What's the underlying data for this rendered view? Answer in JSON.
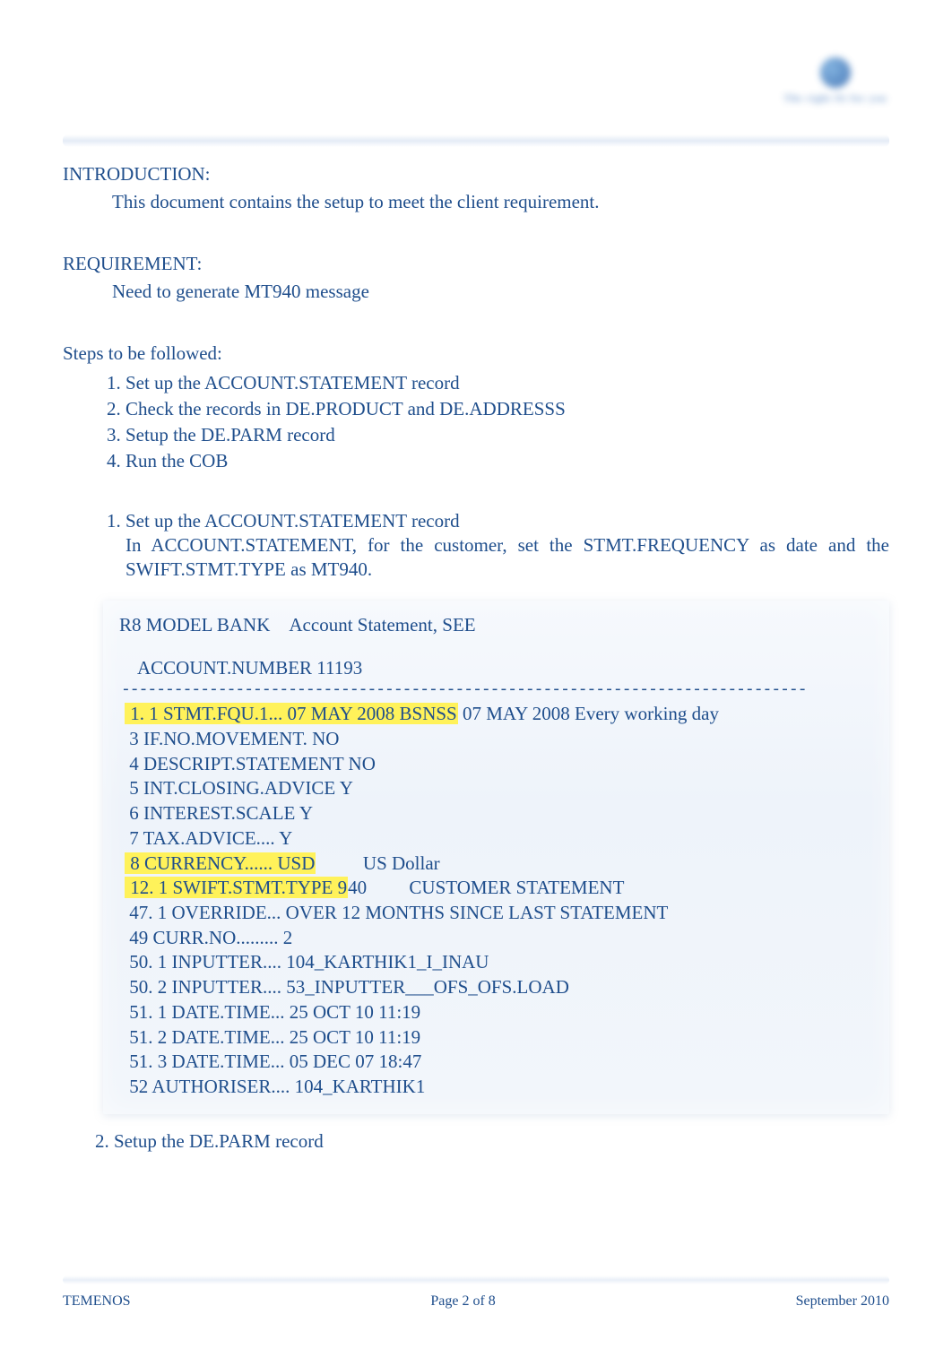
{
  "logo": {
    "name": "brand-logo",
    "caption": "The right fit for you"
  },
  "sections": {
    "intro_head": "INTRODUCTION:",
    "intro_body": "This document contains the setup to meet the client requirement.",
    "req_head": "REQUIREMENT:",
    "req_body": "Need to generate MT940 message",
    "steps_head": "Steps to be followed:",
    "steps": [
      "Set up the ACCOUNT.STATEMENT record",
      "Check the records in DE.PRODUCT and DE.ADDRESSS",
      "Setup the DE.PARM record",
      "Run the COB"
    ],
    "detail1_title": "Set up the ACCOUNT.STATEMENT record",
    "detail1_line1": "In ACCOUNT.STATEMENT, for the customer, set the STMT.FREQUENCY as date and the",
    "detail1_line2": "SWIFT.STMT.TYPE as MT940.",
    "detail2_title": "2.   Setup the DE.PARM record"
  },
  "terminal": {
    "title_left": "R8 MODEL BANK",
    "title_right": "Account Statement, SEE",
    "acct_label": "ACCOUNT.NUMBER",
    "acct_value": "11193",
    "dashes": "------------------------------------------------------------------------------",
    "rows": [
      {
        "hl_prefix": " 1. 1 STMT.FQU.1... 07 MAY 2008 BSNSS",
        "rest": " 07 MAY 2008 Every working day"
      },
      {
        "text": " 3 IF.NO.MOVEMENT. NO"
      },
      {
        "text": " 4 DESCRIPT.STATEMENT NO"
      },
      {
        "text": " 5 INT.CLOSING.ADVICE Y"
      },
      {
        "text": " 6 INTEREST.SCALE Y"
      },
      {
        "text": " 7 TAX.ADVICE.... Y"
      },
      {
        "hl_prefix": " 8 CURRENCY...... USD",
        "rest": "          US Dollar"
      },
      {
        "hl_prefix": " 12. 1 SWIFT.STMT.TYPE 9",
        "rest": "40         CUSTOMER STATEMENT"
      },
      {
        "text": " 47. 1 OVERRIDE... OVER 12 MONTHS SINCE LAST STATEMENT"
      },
      {
        "text": " 49 CURR.NO......... 2"
      },
      {
        "text": " 50. 1 INPUTTER.... 104_KARTHIK1_I_INAU"
      },
      {
        "text": " 50. 2 INPUTTER.... 53_INPUTTER___OFS_OFS.LOAD"
      },
      {
        "text": " 51. 1 DATE.TIME... 25 OCT 10 11:19"
      },
      {
        "text": " 51. 2 DATE.TIME... 25 OCT 10 11:19"
      },
      {
        "text": " 51. 3 DATE.TIME... 05 DEC 07 18:47"
      },
      {
        "text": " 52 AUTHORISER.... 104_KARTHIK1"
      }
    ]
  },
  "footer": {
    "left": "TEMENOS",
    "center": "Page 2 of 8",
    "right": "September 2010"
  }
}
